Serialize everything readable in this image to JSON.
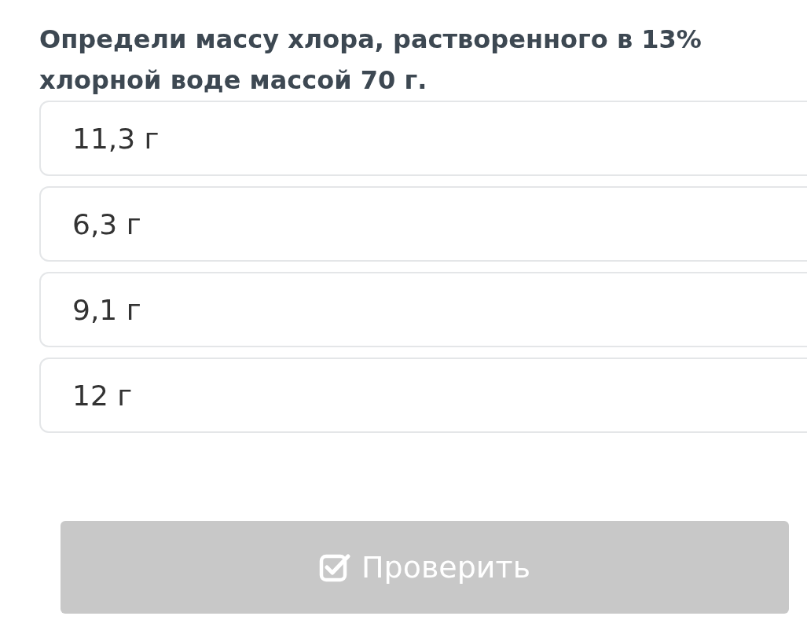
{
  "question": "Определи массу хлора, растворенного в 13% хлорной воде массой 70 г.",
  "options": [
    {
      "label": "11,3 г",
      "selected": false
    },
    {
      "label": "6,3 г",
      "selected": false
    },
    {
      "label": "9,1 г",
      "selected": false
    },
    {
      "label": "12 г",
      "selected": false
    }
  ],
  "check_button": {
    "label": "Проверить",
    "disabled": true
  }
}
